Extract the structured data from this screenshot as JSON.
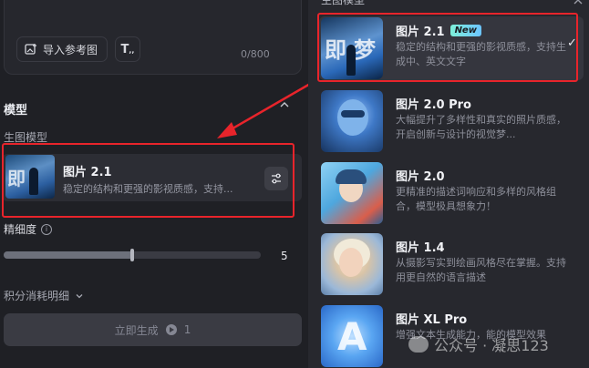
{
  "prompt": {
    "reference_button": "导入参考图",
    "text_button_icon": "text-format-icon",
    "counter": "0/800"
  },
  "model_section": {
    "title": "模型",
    "sub_label": "生图模型",
    "selected_model": {
      "name": "图片 2.1",
      "description": "稳定的结构和更强的影视质感，支持..."
    }
  },
  "precision": {
    "label": "精细度",
    "value": "5",
    "fraction": 0.5
  },
  "points_label": "积分消耗明细",
  "generate_button": {
    "label": "立即生成",
    "cost": "1"
  },
  "dropdown": {
    "header": "生图模型",
    "options": [
      {
        "name": "图片 2.1",
        "badge": "New",
        "description": "稳定的结构和更强的影视质感，支持生成中、英文文字",
        "selected": true
      },
      {
        "name": "图片 2.0 Pro",
        "description": "大幅提升了多样性和真实的照片质感，开启创新与设计的视觉梦..."
      },
      {
        "name": "图片 2.0",
        "description": "更精准的描述词响应和多样的风格组合，模型极具想象力！"
      },
      {
        "name": "图片 1.4",
        "description": "从摄影写实到绘画风格尽在掌握。支持用更自然的语言描述"
      },
      {
        "name": "图片 XL Pro",
        "description": "增强文本生成能力，能的模型效果"
      }
    ]
  },
  "watermark": {
    "text": "公众号 · 凝思123"
  },
  "colors": {
    "highlight_red": "#e8242b",
    "badge_gradient": "#7ef0d9"
  }
}
